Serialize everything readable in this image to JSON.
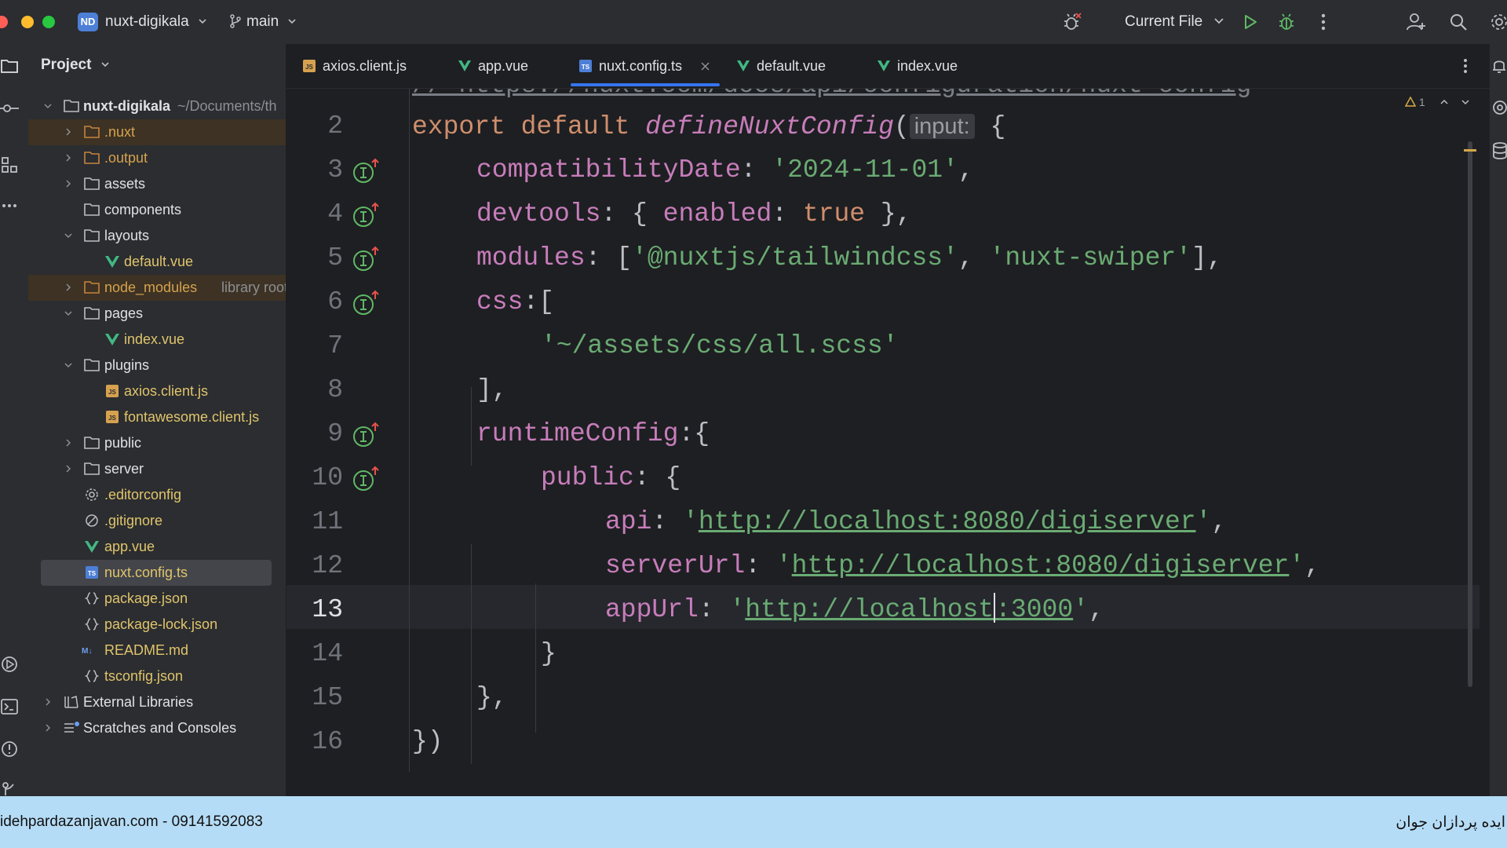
{
  "titlebar": {
    "project_badge": "ND",
    "project_name": "nuxt-digikala",
    "branch": "main",
    "run_config": "Current File"
  },
  "sidebar": {
    "header": "Project",
    "root_name": "nuxt-digikala",
    "root_path": "~/Documents/th",
    "items": [
      {
        "label": ".nuxt"
      },
      {
        "label": ".output"
      },
      {
        "label": "assets"
      },
      {
        "label": "components"
      },
      {
        "label": "layouts"
      },
      {
        "label": "default.vue"
      },
      {
        "label": "node_modules",
        "hint": "library root"
      },
      {
        "label": "pages"
      },
      {
        "label": "index.vue"
      },
      {
        "label": "plugins"
      },
      {
        "label": "axios.client.js"
      },
      {
        "label": "fontawesome.client.js"
      },
      {
        "label": "public"
      },
      {
        "label": "server"
      },
      {
        "label": ".editorconfig"
      },
      {
        "label": ".gitignore"
      },
      {
        "label": "app.vue"
      },
      {
        "label": "nuxt.config.ts"
      },
      {
        "label": "package.json"
      },
      {
        "label": "package-lock.json"
      },
      {
        "label": "README.md"
      },
      {
        "label": "tsconfig.json"
      },
      {
        "label": "External Libraries"
      },
      {
        "label": "Scratches and Consoles"
      }
    ]
  },
  "tabs": [
    {
      "label": "axios.client.js",
      "icon": "js-file-icon"
    },
    {
      "label": "app.vue",
      "icon": "vue-file-icon"
    },
    {
      "label": "nuxt.config.ts",
      "icon": "ts-file-icon",
      "active": true
    },
    {
      "label": "default.vue",
      "icon": "vue-file-icon"
    },
    {
      "label": "index.vue",
      "icon": "vue-file-icon"
    }
  ],
  "editor": {
    "top_partial": "// https://nuxt.com/docs/api/configuration/nuxt-config",
    "line_numbers": [
      "2",
      "3",
      "4",
      "5",
      "6",
      "7",
      "8",
      "9",
      "10",
      "11",
      "12",
      "13",
      "14",
      "15",
      "16"
    ],
    "current_line": "13",
    "warnings": "1",
    "code": {
      "l2_export": "export default ",
      "l2_fn": "defineNuxtConfig",
      "l2_open": "(",
      "l2_hint": "input:",
      "l2_brace": " {",
      "l3_key": "compatibilityDate",
      "l3_colon": ": ",
      "l3_val": "'2024-11-01'",
      "l3_end": ",",
      "l4_key": "devtools",
      "l4_mid": ": { ",
      "l4_key2": "enabled",
      "l4_colon": ": ",
      "l4_val": "true",
      "l4_end": " },",
      "l5_key": "modules",
      "l5_mid": ": [",
      "l5_val1": "'@nuxtjs/tailwindcss'",
      "l5_sep": ", ",
      "l5_val2": "'nuxt-swiper'",
      "l5_end": "],",
      "l6_key": "css",
      "l6_end": ":[",
      "l7_val": "'~/assets/css/all.scss'",
      "l8_end": "],",
      "l9_key": "runtimeConfig",
      "l9_end": ":{",
      "l10_key": "public",
      "l10_end": ": {",
      "l11_key": "api",
      "l11_colon": ": ",
      "l11_q1": "'",
      "l11_url": "http://localhost:8080/digiserver",
      "l11_q2": "'",
      "l11_end": ",",
      "l12_key": "serverUrl",
      "l12_colon": ": ",
      "l12_q1": "'",
      "l12_url": "http://localhost:8080/digiserver",
      "l12_q2": "'",
      "l12_end": ",",
      "l13_key": "appUrl",
      "l13_colon": ": ",
      "l13_q1": "'",
      "l13_url_a": "http://localhost",
      "l13_url_b": ":3000",
      "l13_q2": "'",
      "l13_end": ",",
      "l14_end": "}",
      "l15_end": "},",
      "l16_end": "})"
    }
  },
  "footer": {
    "left": "idehpardazanjavan.com - 09141592083",
    "right": "ایده پردازان جوان"
  },
  "colors": {
    "accent": "#3574f0",
    "keyword": "#cf8e6d",
    "property": "#c77dbb",
    "string": "#6aab73",
    "footer_bg": "#b5dcf6"
  }
}
